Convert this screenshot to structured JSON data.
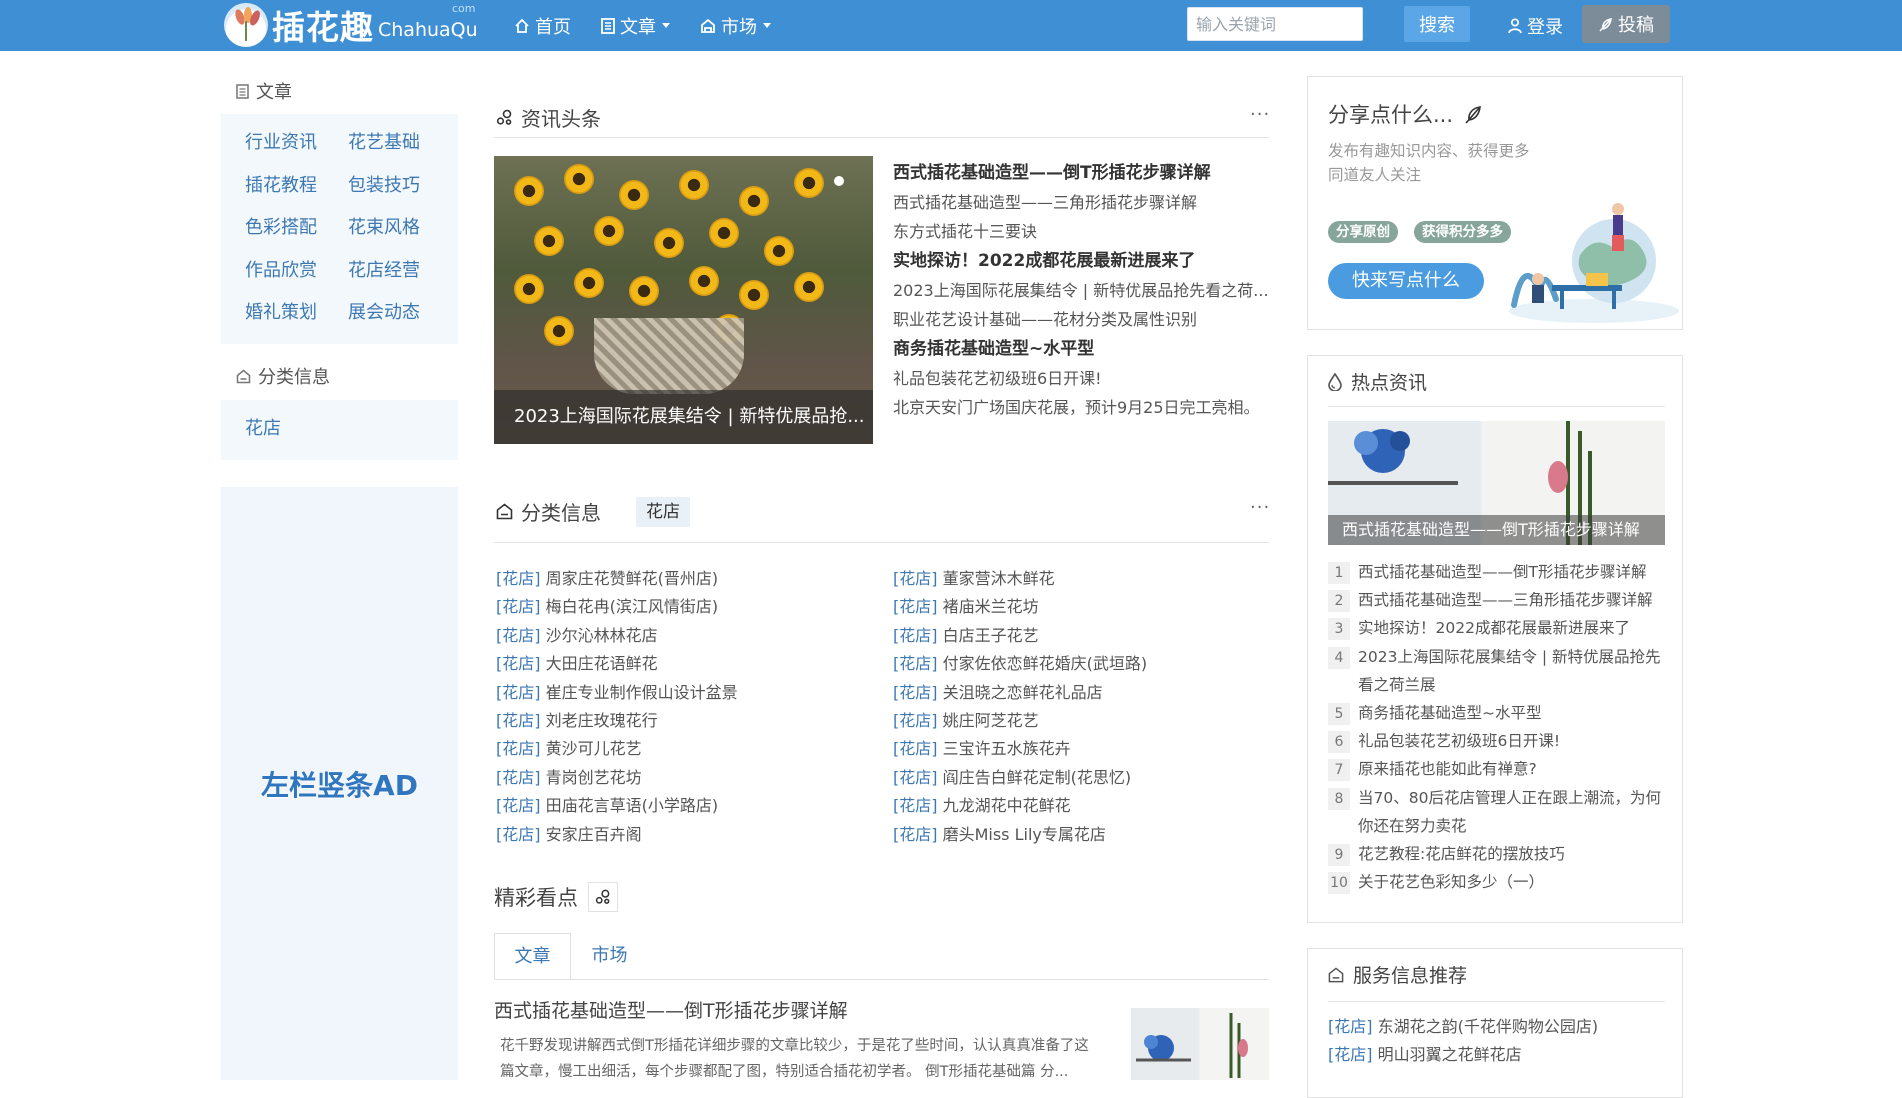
{
  "header": {
    "logo_cn": "插花趣",
    "logo_en": "ChahuaQu",
    "logo_com": "com",
    "nav": [
      {
        "label": "首页",
        "icon": "home-icon"
      },
      {
        "label": "文章",
        "icon": "article-icon"
      },
      {
        "label": "市场",
        "icon": "shop-icon"
      }
    ],
    "search_placeholder": "输入关键词",
    "search_button": "搜索",
    "login": "登录",
    "submit": "投稿",
    "colors": {
      "bar": "#3f8fd4",
      "search_button": "#5ba6e6",
      "submit_button": "#7c8c99"
    }
  },
  "left_sidebar": {
    "articles_heading": "文章",
    "article_links": [
      "行业资讯",
      "花艺基础",
      "插花教程",
      "包装技巧",
      "色彩搭配",
      "花束风格",
      "作品欣赏",
      "花店经营",
      "婚礼策划",
      "展会动态"
    ],
    "category_heading": "分类信息",
    "category_links": [
      "花店"
    ],
    "ad_text": "左栏竖条AD"
  },
  "headlines": {
    "title": "资讯头条",
    "more": "···",
    "feature_caption": "2023上海国际花展集结令 | 新特优展品抢...",
    "items": [
      {
        "text": "西式插花基础造型——倒T形插花步骤详解",
        "bold": true
      },
      {
        "text": "西式插花基础造型——三角形插花步骤详解",
        "bold": false
      },
      {
        "text": "东方式插花十三要诀",
        "bold": false
      },
      {
        "text": "实地探访！2022成都花展最新进展来了",
        "bold": true
      },
      {
        "text": "2023上海国际花展集结令 | 新特优展品抢先看之荷...",
        "bold": false
      },
      {
        "text": "职业花艺设计基础——花材分类及属性识别",
        "bold": false
      },
      {
        "text": "商务插花基础造型~水平型",
        "bold": true
      },
      {
        "text": "礼品包装花艺初级班6日开课!",
        "bold": false
      },
      {
        "text": "北京天安门广场国庆花展，预计9月25日完工亮相。",
        "bold": false
      }
    ]
  },
  "category_info": {
    "title": "分类信息",
    "tag": "花店",
    "more": "···",
    "prefix": "[花店]",
    "left": [
      "周家庄花赞鲜花(晋州店)",
      "梅白花冉(滨江风情街店)",
      "沙尔沁林林花店",
      "大田庄花语鲜花",
      "崔庄专业制作假山设计盆景",
      "刘老庄玫瑰花行",
      "黄沙可儿花艺",
      "青岗创艺花坊",
      "田庙花言草语(小学路店)",
      "安家庄百卉阁"
    ],
    "right": [
      "董家营沐木鲜花",
      "褚庙米兰花坊",
      "白店王子花艺",
      "付家佐依恋鲜花婚庆(武垣路)",
      "关沮晓之恋鲜花礼品店",
      "姚庄阿芝花艺",
      "三宝许五水族花卉",
      "阎庄告白鲜花定制(花思忆)",
      "九龙湖花中花鲜花",
      "磨头Miss Lily专属花店"
    ]
  },
  "highlights": {
    "title": "精彩看点",
    "tabs": [
      "文章",
      "市场"
    ],
    "article_title": "西式插花基础造型——倒T形插花步骤详解",
    "article_desc": "花千野发现讲解西式倒T形插花详细步骤的文章比较少，于是花了些时间，认认真真准备了这篇文章，慢工出细活，每个步骤都配了图，特别适合插花初学者。 倒T形插花基础篇 分..."
  },
  "share_card": {
    "title": "分享点什么...",
    "desc": "发布有趣知识内容、获得更多同道友人关注",
    "pills": [
      "分享原创",
      "获得积分多多"
    ],
    "cta": "快来写点什么"
  },
  "hot_news": {
    "title": "热点资讯",
    "image_caption": "西式插花基础造型——倒T形插花步骤详解",
    "items": [
      {
        "num": "1",
        "text": "西式插花基础造型——倒T形插花步骤详解"
      },
      {
        "num": "2",
        "text": "西式插花基础造型——三角形插花步骤详解"
      },
      {
        "num": "3",
        "text": "实地探访！2022成都花展最新进展来了"
      },
      {
        "num": "4",
        "text": "2023上海国际花展集结令 | 新特优展品抢先看之荷兰展"
      },
      {
        "num": "5",
        "text": "商务插花基础造型~水平型"
      },
      {
        "num": "6",
        "text": "礼品包装花艺初级班6日开课!"
      },
      {
        "num": "7",
        "text": "原来插花也能如此有禅意?"
      },
      {
        "num": "8",
        "text": "当70、80后花店管理人正在跟上潮流，为何你还在努力卖花"
      },
      {
        "num": "9",
        "text": "花艺教程:花店鲜花的摆放技巧"
      },
      {
        "num": "10",
        "text": "关于花艺色彩知多少（一）"
      }
    ]
  },
  "services": {
    "title": "服务信息推荐",
    "prefix": "[花店]",
    "items": [
      "东湖花之韵(千花伴购物公园店)",
      "明山羽翼之花鲜花店"
    ]
  }
}
